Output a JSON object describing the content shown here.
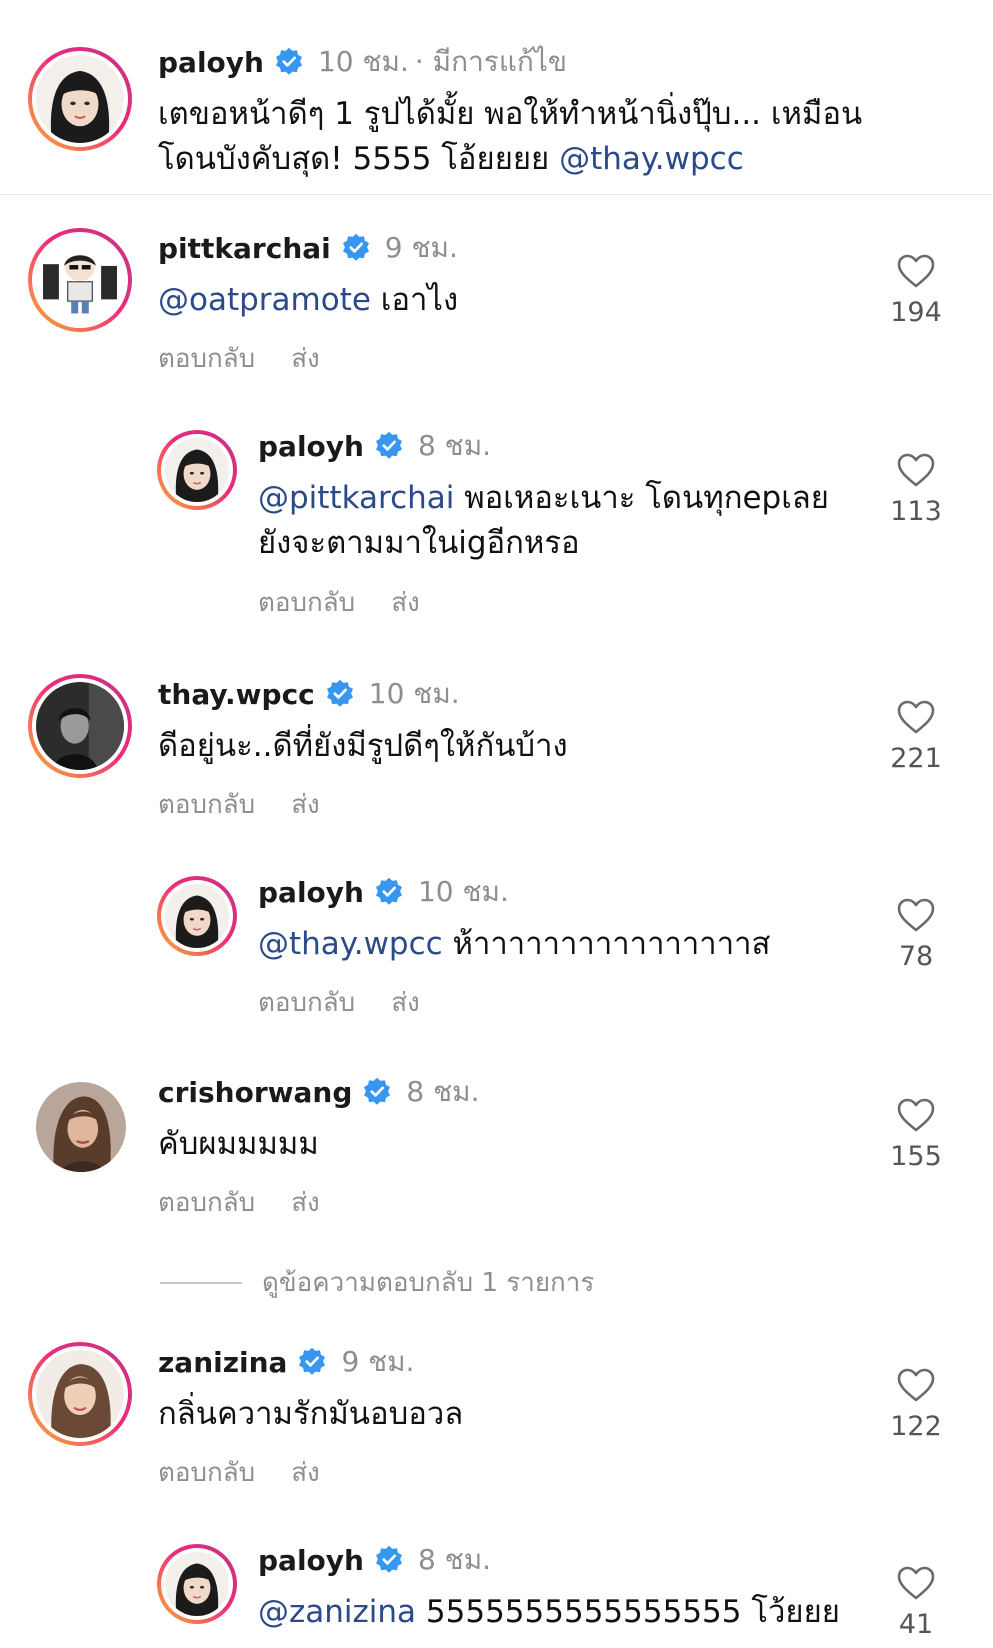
{
  "caption": {
    "username": "paloyh",
    "time": "10 ชม.",
    "edited": "· มีการแก้ไข",
    "text_line1": "เตขอหน้าดีๆ 1 รูปได้มั้ย พอให้ทำหน้านิ่งปุ๊บ... เหมือน",
    "text_line2": "โดนบังคับสุด! 5555 โอ้ยยยย ",
    "mention": "@thay.wpcc"
  },
  "labels": {
    "reply": "ตอบกลับ",
    "send": "ส่ง",
    "view_replies": "ดูข้อความตอบกลับ 1 รายการ"
  },
  "comments": [
    {
      "username": "pittkarchai",
      "time": "9 ชม.",
      "mention": "@oatpramote",
      "text": " เอาไง",
      "likes": "194"
    },
    {
      "username": "paloyh",
      "time": "8 ชม.",
      "mention": "@pittkarchai",
      "text": " พอเหอะเนาะ โดนทุกepเลย",
      "text2": "ยังจะตามมาในigอีกหรอ",
      "likes": "113"
    },
    {
      "username": "thay.wpcc",
      "time": "10 ชม.",
      "text": "ดีอยู่นะ..ดีที่ยังมีรูปดีๆให้กันบ้าง",
      "likes": "221"
    },
    {
      "username": "paloyh",
      "time": "10 ชม.",
      "mention": "@thay.wpcc",
      "text": " ห้าาาาาาาาาาาาาาาาส",
      "likes": "78"
    },
    {
      "username": "crishorwang",
      "time": "8 ชม.",
      "text": "คับผมมมมม",
      "likes": "155"
    },
    {
      "username": "zanizina",
      "time": "9 ชม.",
      "text": "กลิ่นความรักมันอบอวล",
      "likes": "122"
    },
    {
      "username": "paloyh",
      "time": "8 ชม.",
      "mention": "@zanizina",
      "text": " 5555555555555555 โว้ยยย",
      "likes": "41"
    }
  ],
  "colors": {
    "mention": "#2b4a8a",
    "verified": "#3797f0",
    "muted": "#8e8e8e"
  }
}
